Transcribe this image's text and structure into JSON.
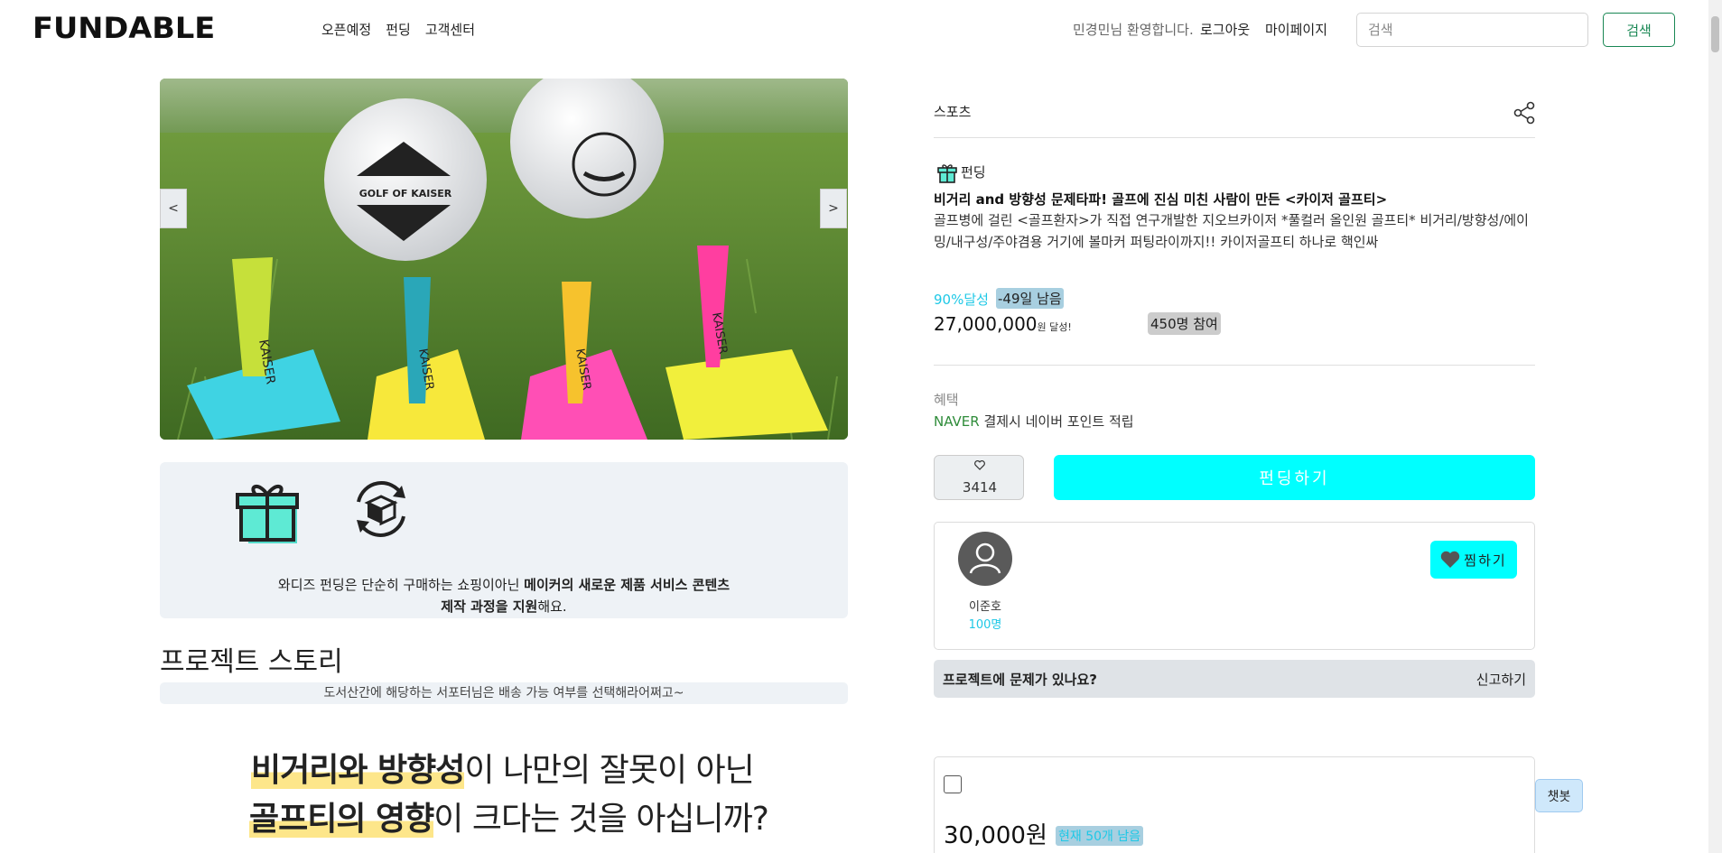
{
  "header": {
    "logo": "FUNDABLE",
    "nav": [
      "오픈예정",
      "펀딩",
      "고객센터"
    ],
    "welcome": "민경민님 환영합니다.",
    "logout": "로그아웃",
    "mypage": "마이페이지",
    "search_placeholder": "검색",
    "search_button": "검색"
  },
  "carousel": {
    "prev": "<",
    "next": ">",
    "ball_text": "GOLF OF KAISER",
    "tee_text": "KAISER"
  },
  "info_box": {
    "text_plain": "와디즈 펀딩은 단순히 구매하는 쇼핑이아닌 ",
    "text_bold1": "메이커의 새로운 제품 서비스 콘텐츠",
    "text_bold2": "제작 과정을 지원",
    "text_end": "해요."
  },
  "story": {
    "title": "프로젝트 스토리",
    "notice": "도서산간에 해당하는 서포터님은 배송 가능 여부를 선택해라어쩌고~",
    "line1_hl": "비거리와 방향성",
    "line1_rest": "이 나만의 잘못이 아닌",
    "line2_hl": "골프티의 영향",
    "line2_rest": "이 크다는 것을 아십니까?"
  },
  "project": {
    "category": "스포츠",
    "type": "펀딩",
    "title": "비거리 and 방향성 문제타파! 골프에 진심 미친 사람이 만든 <카이저 골프티>",
    "description": "골프병에 걸린 <골프환자>가 직접 연구개발한 지오브카이저 *풀컬러 올인원 골프티* 비거리/방향성/에이밍/내구성/주야겸용 거기에 볼마커 퍼팅라이까지!! 카이저골프티 하나로 핵인싸",
    "achieve": "90%달성",
    "days_left": "-49일 남음",
    "amount": "27,000,000",
    "amount_unit": "원 달성!",
    "participants": "450명 참여",
    "benefit_label": "혜택",
    "benefit_brand": "NAVER",
    "benefit_text": " 결제시 네이버 포인트 적립",
    "like_count": "3414",
    "fund_button": "펀딩하기"
  },
  "maker": {
    "name": "이준호",
    "count": "100명",
    "wish_button": "찜하기"
  },
  "report": {
    "question": "프로젝트에 문제가 있나요?",
    "link": "신고하기"
  },
  "reward": {
    "price": "30,000원",
    "remaining": "현재 50개 남음"
  },
  "chatbot": "챗봇",
  "colors": {
    "accent_cyan": "#00ffff",
    "link_cyan": "#1ec8e6",
    "search_green": "#198754",
    "naver_green": "#2f8c3a"
  }
}
